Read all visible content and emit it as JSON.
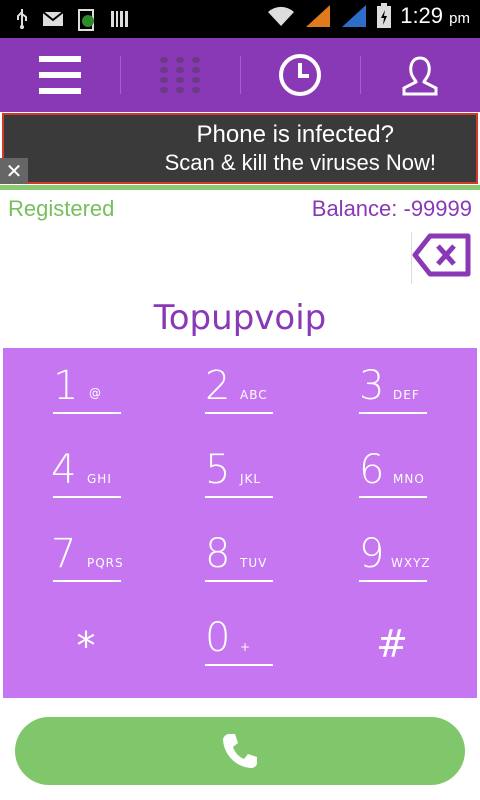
{
  "status_bar": {
    "time": "1:29",
    "ampm": "pm"
  },
  "toolbar": {
    "items": [
      {
        "name": "menu"
      },
      {
        "name": "dialpad"
      },
      {
        "name": "history"
      },
      {
        "name": "contacts"
      }
    ]
  },
  "ad": {
    "line1": "Phone is infected?",
    "line2": "Scan & kill the viruses Now!",
    "close": "✕"
  },
  "account": {
    "status": "Registered",
    "balance": "Balance: -99999"
  },
  "brand": "Topupvoip",
  "keypad": {
    "keys": [
      {
        "digit": "1",
        "letters": "@"
      },
      {
        "digit": "2",
        "letters": "ABC"
      },
      {
        "digit": "3",
        "letters": "DEF"
      },
      {
        "digit": "4",
        "letters": "GHI"
      },
      {
        "digit": "5",
        "letters": "JKL"
      },
      {
        "digit": "6",
        "letters": "MNO"
      },
      {
        "digit": "7",
        "letters": "PQRS"
      },
      {
        "digit": "8",
        "letters": "TUV"
      },
      {
        "digit": "9",
        "letters": "WXYZ"
      },
      {
        "digit": "*",
        "letters": ""
      },
      {
        "digit": "0",
        "letters": "+"
      },
      {
        "digit": "#",
        "letters": ""
      }
    ]
  },
  "colors": {
    "brand_purple": "#8a39b6",
    "keypad_bg": "#c676f0",
    "call_green": "#7fc76a",
    "registered_green": "#76bf5c"
  }
}
